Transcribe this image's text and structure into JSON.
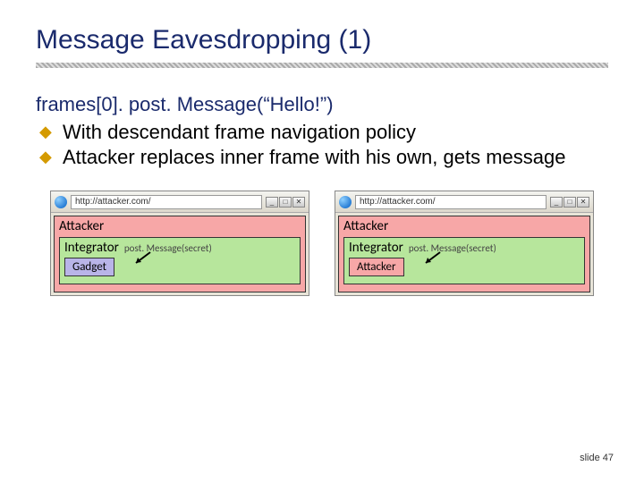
{
  "title": "Message Eavesdropping (1)",
  "code_line": "frames[0]. post. Message(“Hello!”)",
  "bullets": [
    "With descendant frame navigation policy",
    "Attacker replaces inner frame with his own, gets message"
  ],
  "browsers": [
    {
      "url": "http://attacker.com/",
      "outer_label": "Attacker",
      "integrator_label": "Integrator",
      "post_label": "post. Message(secret)",
      "inner_label": "Gadget",
      "inner_variant": "gadget"
    },
    {
      "url": "http://attacker.com/",
      "outer_label": "Attacker",
      "integrator_label": "Integrator",
      "post_label": "post. Message(secret)",
      "inner_label": "Attacker",
      "inner_variant": "attacker"
    }
  ],
  "window_buttons": {
    "min": "_",
    "max": "□",
    "close": "✕"
  },
  "slide_number": "slide 47"
}
